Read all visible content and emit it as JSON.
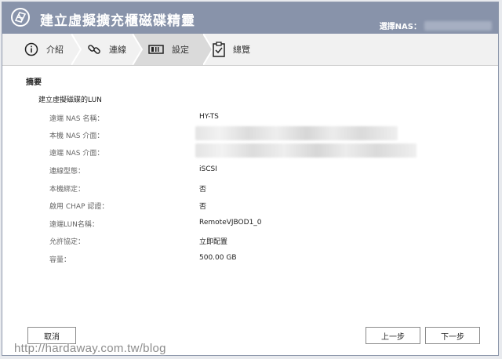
{
  "window": {
    "title": "建立虛擬擴充櫃磁碟精靈",
    "nas_select_label": "選擇NAS："
  },
  "steps": [
    {
      "label": "介紹",
      "icon": "info-icon",
      "active": false
    },
    {
      "label": "連線",
      "icon": "link-icon",
      "active": false
    },
    {
      "label": "設定",
      "icon": "drive-settings-icon",
      "active": true
    },
    {
      "label": "總覽",
      "icon": "clipboard-check-icon",
      "active": false
    }
  ],
  "summary": {
    "title": "摘要",
    "section_title": "建立虛擬磁碟的LUN",
    "rows": [
      {
        "label": "遠端 NAS 名稱：",
        "value": "HY-TS"
      },
      {
        "label": "本機 NAS 介面：",
        "value": ""
      },
      {
        "label": "遠端 NAS 介面：",
        "value": ""
      },
      {
        "label": "連線型態：",
        "value": "iSCSI"
      },
      {
        "label": "本機綁定：",
        "value": "否"
      },
      {
        "label": "啟用 CHAP 認證：",
        "value": "否"
      },
      {
        "label": "遠端LUN名稱：",
        "value": "RemoteVJBOD1_0"
      },
      {
        "label": "允許協定：",
        "value": "立即配置"
      },
      {
        "label": "容量：",
        "value": "500.00 GB"
      }
    ]
  },
  "buttons": {
    "cancel": "取消",
    "back": "上一步",
    "next": "下一步"
  },
  "watermark": "http://hardaway.com.tw/blog",
  "colors": {
    "titlebar": "#8893aa",
    "active_step": "#dadada",
    "stepbar": "#f1f1f1"
  }
}
